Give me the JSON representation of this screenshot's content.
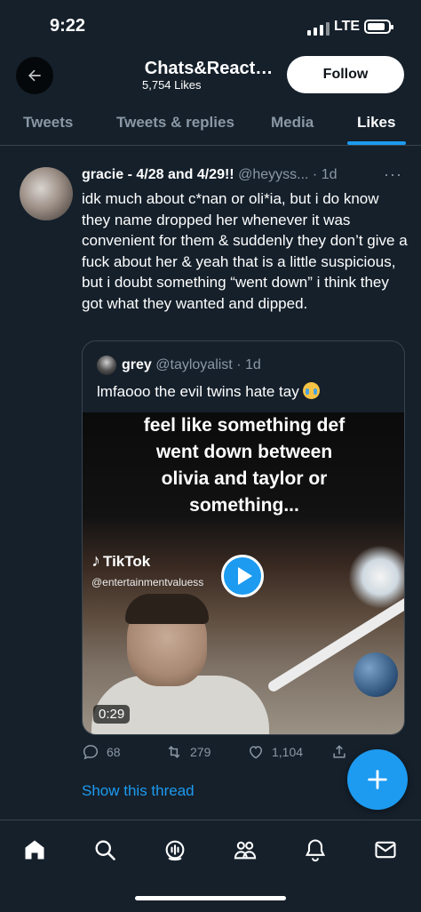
{
  "status_bar": {
    "time": "9:22",
    "network": "LTE"
  },
  "header": {
    "title": "Chats&React…",
    "subtitle": "5,754 Likes",
    "follow_label": "Follow"
  },
  "tabs": [
    {
      "label": "Tweets",
      "active": false
    },
    {
      "label": "Tweets & replies",
      "active": false
    },
    {
      "label": "Media",
      "active": false
    },
    {
      "label": "Likes",
      "active": true
    }
  ],
  "tweet": {
    "author_name": "gracie - 4/28 and 4/29!!",
    "meta": "@heyyss... · 1d",
    "more_label": "···",
    "text": "idk much about c*nan or oli*ia, but i do know they name dropped her whenever it was convenient for them & suddenly they don’t give a fuck about her & yeah that is a little suspicious, but i doubt something “went down” i think they got what they wanted and dipped.",
    "quote": {
      "author_name": "grey",
      "meta": "@tayloyalist · 1d",
      "text": "lmfaooo the evil twins hate tay",
      "emoji": "loudly-crying-face",
      "video": {
        "caption_lines": [
          "feel like something def",
          "went down between",
          "olivia and taylor or",
          "something..."
        ],
        "watermark": "TikTok",
        "watermark_user": "@entertainmentvaluess",
        "duration": "0:29"
      }
    },
    "actions": {
      "replies": "68",
      "retweets": "279",
      "likes": "1,104"
    },
    "show_thread_label": "Show this thread"
  },
  "bottom_nav": [
    "home-icon",
    "search-icon",
    "spaces-icon",
    "communities-icon",
    "notifications-icon",
    "messages-icon"
  ],
  "colors": {
    "background": "#15202b",
    "accent": "#1d9bf0",
    "muted": "#8b98a5",
    "divider": "#38444d"
  }
}
